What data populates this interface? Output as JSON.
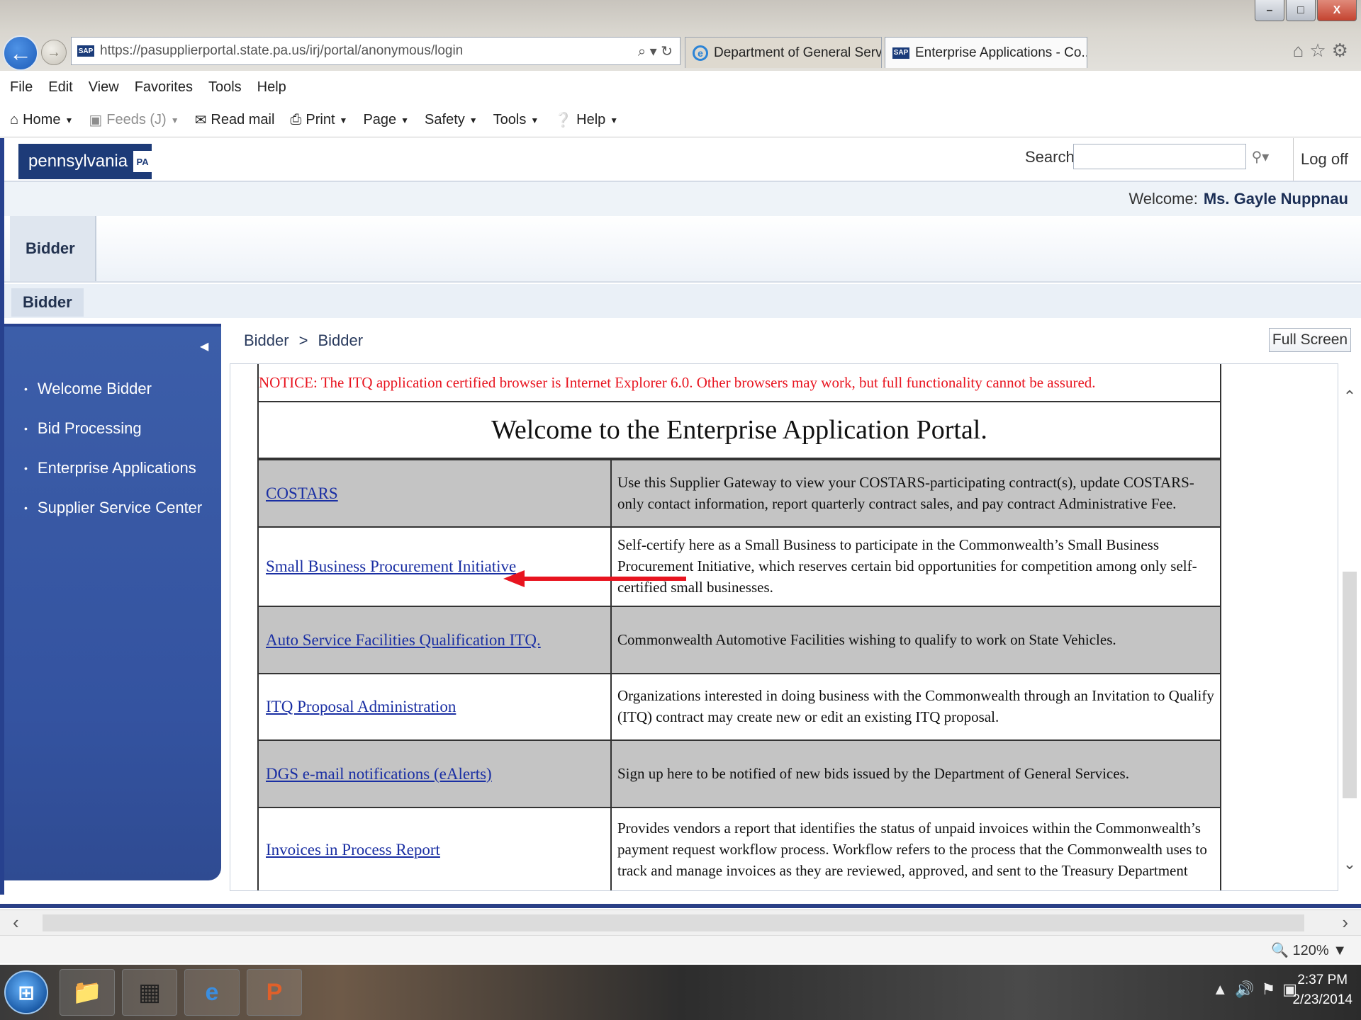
{
  "browser": {
    "url": "https://pasupplierportal.state.pa.us/irj/portal/anonymous/login",
    "address_tools": "⌕ ▾ ↻",
    "tabs": [
      {
        "label": "Department of General Services"
      },
      {
        "label": "Enterprise Applications - Co..."
      }
    ],
    "window_controls": [
      "–",
      "□",
      "X"
    ],
    "top_icons": "⌂☆⚙",
    "menu": [
      "File",
      "Edit",
      "View",
      "Favorites",
      "Tools",
      "Help"
    ],
    "commands": [
      {
        "label": "Home",
        "icon": "home-icon"
      },
      {
        "label": "Feeds (J)",
        "icon": "feeds-icon"
      },
      {
        "label": "Read mail",
        "icon": "mail-icon"
      },
      {
        "label": "Print",
        "icon": "print-icon"
      },
      {
        "label": "Page",
        "icon": ""
      },
      {
        "label": "Safety",
        "icon": ""
      },
      {
        "label": "Tools",
        "icon": ""
      },
      {
        "label": "Help",
        "icon": "help-icon"
      }
    ],
    "zoom": "120%"
  },
  "portal": {
    "logo_text": "pennsylvania",
    "logo_badge": "PA",
    "search_label": "Search:",
    "search_value": "",
    "logoff_label": "Log off",
    "welcome_prefix": "Welcome:",
    "welcome_user": "Ms. Gayle Nuppnau",
    "top_tab": "Bidder",
    "sub_tab": "Bidder",
    "nav_items": [
      "Welcome Bidder",
      "Bid Processing",
      "Enterprise Applications",
      "Supplier Service Center"
    ],
    "breadcrumb": [
      "Bidder",
      ">",
      "Bidder"
    ],
    "fullscreen_label": "Full Screen"
  },
  "content": {
    "notice": "NOTICE: The ITQ application certified browser is Internet Explorer 6.0. Other browsers may work, but full functionality cannot be assured.",
    "title": "Welcome to the Enterprise Application Portal.",
    "apps": [
      {
        "name": "COSTARS",
        "description": "Use this Supplier Gateway to view your COSTARS-participating contract(s), update COSTARS-only contact information, report quarterly contract sales, and pay contract Administrative Fee."
      },
      {
        "name": "Small Business Procurement Initiative",
        "description": "Self-certify here as a Small Business to participate in the Commonwealth’s Small Business Procurement Initiative, which reserves certain bid opportunities for competition among only self-certified small businesses."
      },
      {
        "name": "Auto Service Facilities Qualification ITQ.",
        "description": "Commonwealth Automotive Facilities wishing to qualify to work on State Vehicles."
      },
      {
        "name": "ITQ Proposal Administration",
        "description": "Organizations interested in doing business with the Commonwealth through an Invitation to Qualify (ITQ) contract may create new or edit an existing ITQ proposal."
      },
      {
        "name": "DGS e-mail notifications (eAlerts)",
        "description": "Sign up here to be notified of new bids issued by the Department of General Services."
      },
      {
        "name": "Invoices in Process Report",
        "description": "Provides vendors a report that identifies the status of unpaid invoices within the Commonwealth’s payment request workflow process. Workflow refers to the process that the Commonwealth uses to track and manage invoices as they are reviewed, approved, and sent to the Treasury Department"
      }
    ]
  },
  "taskbar": {
    "time": "2:37 PM",
    "date": "2/23/2014"
  },
  "colors": {
    "nav_blue": "#3453a0",
    "notice_red": "#e8141f",
    "link_blue": "#1a2fa3",
    "row_gray": "#c4c4c4",
    "arrow_red": "#e8141f"
  }
}
